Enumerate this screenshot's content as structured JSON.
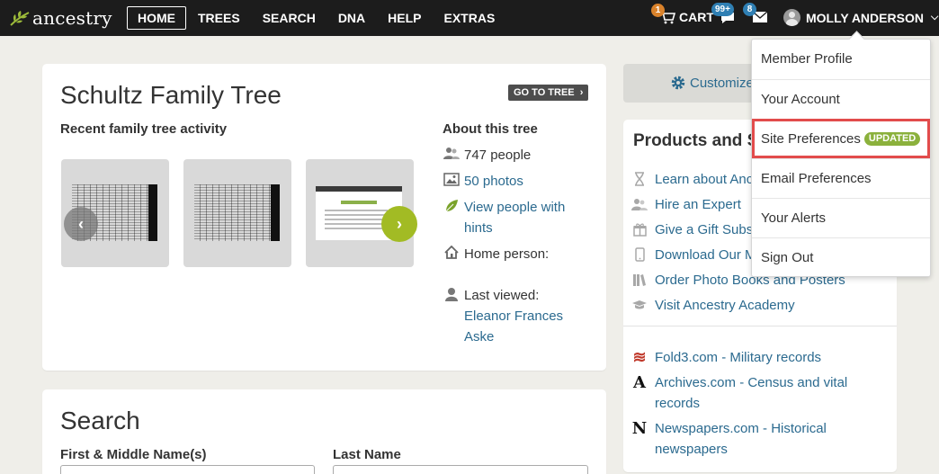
{
  "header": {
    "logo_text": "ancestry",
    "nav": [
      {
        "label": "HOME",
        "active": true
      },
      {
        "label": "TREES"
      },
      {
        "label": "SEARCH"
      },
      {
        "label": "DNA"
      },
      {
        "label": "HELP"
      },
      {
        "label": "EXTRAS"
      }
    ],
    "cart_label": "CART",
    "cart_count": "1",
    "messages_count": "99+",
    "mail_count": "8",
    "user_name": "MOLLY ANDERSON"
  },
  "tree": {
    "title": "Schultz Family Tree",
    "goto_label": "GO TO TREE",
    "recent_heading": "Recent family tree activity",
    "about_heading": "About this tree",
    "people": "747 people",
    "photos": "50 photos",
    "hints_line1": "View people with",
    "hints_line2": "hints",
    "home_person": "Home person:",
    "last_viewed_label": "Last viewed:",
    "last_viewed_name_line1": "Eleanor Frances",
    "last_viewed_name_line2": "Aske"
  },
  "search": {
    "title": "Search",
    "first_middle_label": "First & Middle Name(s)",
    "last_name_label": "Last Name"
  },
  "customize_label": "Customize",
  "products": {
    "title": "Products and Se",
    "items": [
      {
        "label": "Learn about Anc",
        "icon": "hourglass-icon"
      },
      {
        "label": "Hire an Expert",
        "icon": "people-icon"
      },
      {
        "label": "Give a Gift Subsc",
        "icon": "gift-icon"
      },
      {
        "label": "Download Our M",
        "icon": "phone-icon"
      },
      {
        "label": "Order Photo Books and Posters",
        "icon": "books-icon"
      },
      {
        "label": "Visit Ancestry Academy",
        "icon": "graduation-cap-icon"
      }
    ],
    "partners": [
      {
        "line1": "Fold3.com - Military records",
        "line2": "",
        "icon_char": "≋"
      },
      {
        "line1": "Archives.com - Census and vital",
        "line2": "records",
        "icon_char": "A"
      },
      {
        "line1": "Newspapers.com - Historical",
        "line2": "newspapers",
        "icon_char": "N"
      }
    ]
  },
  "dropdown": {
    "items": [
      {
        "label": "Member Profile"
      },
      {
        "label": "Your Account"
      },
      {
        "label": "Site Preferences",
        "badge": "UPDATED",
        "highlighted": true
      },
      {
        "label": "Email Preferences"
      },
      {
        "label": "Your Alerts"
      },
      {
        "label": "Sign Out"
      }
    ]
  },
  "colors": {
    "topbar": "#1c1c1c",
    "link": "#2b6a8f",
    "accent_green": "#a2bb24",
    "badge_orange": "#d9822b",
    "badge_blue": "#2f7fb3",
    "highlight_red": "#e24c4c"
  }
}
